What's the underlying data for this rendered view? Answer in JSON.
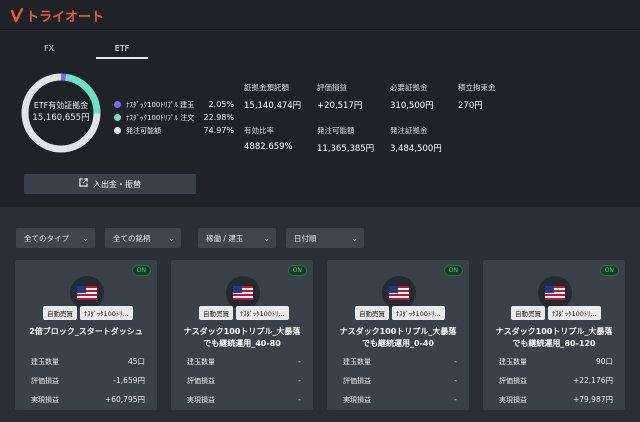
{
  "brand": {
    "name": "トライオート",
    "color": "#e85a3a"
  },
  "tabs": [
    {
      "label": "FX"
    },
    {
      "label": "ETF"
    }
  ],
  "summary": {
    "donut_label": "ETF有効証拠金",
    "donut_value": "15,160,655円",
    "legend": [
      {
        "name": "ﾅｽﾀﾞｯｸ100ﾄﾘﾌﾟﾙ 建玉",
        "pct": "2.05%",
        "color": "#7b68ee",
        "fraction": 0.0205
      },
      {
        "name": "ﾅｽﾀﾞｯｸ100ﾄﾘﾌﾟﾙ 注文",
        "pct": "22.98%",
        "color": "#6fe0c8",
        "fraction": 0.2298
      },
      {
        "name": "発注可能額",
        "pct": "74.97%",
        "color": "#e0e3e6",
        "fraction": 0.7497
      }
    ],
    "stats": [
      {
        "label": "証拠金預託額",
        "value": "15,140,474円"
      },
      {
        "label": "評価損益",
        "value": "+20,517円"
      },
      {
        "label": "必要証拠金",
        "value": "310,500円"
      },
      {
        "label": "積立拘束金",
        "value": "270円"
      },
      {
        "label": "有効比率",
        "value": "4882.659%"
      },
      {
        "label": "発注可能額",
        "value": "11,365,385円"
      },
      {
        "label": "発注証拠金",
        "value": "3,484,500円"
      }
    ],
    "deposit_button": "入出金・振替",
    "deposit_icon": "external-link-icon"
  },
  "filters": [
    {
      "label": "全てのタイプ"
    },
    {
      "label": "全ての銘柄"
    },
    {
      "label": "稼働 / 建玉"
    },
    {
      "label": "日付順"
    }
  ],
  "cards": [
    {
      "status": "ON",
      "tags": [
        "自動売買",
        "ﾅｽﾀﾞｯｸ100ﾄﾘ..."
      ],
      "title_line1": "2倍ブロック_スタートダッシュ",
      "title_line2": "",
      "rows": [
        {
          "label": "建玉数量",
          "value": "45口"
        },
        {
          "label": "評価損益",
          "value": "-1,659円"
        },
        {
          "label": "実現損益",
          "value": "+60,795円"
        }
      ]
    },
    {
      "status": "ON",
      "tags": [
        "自動売買",
        "ﾅｽﾀﾞｯｸ100ﾄﾘ..."
      ],
      "title_line1": "ナスダック100トリプル_大暴落",
      "title_line2": "でも継続運用_40-80",
      "rows": [
        {
          "label": "建玉数量",
          "value": "-"
        },
        {
          "label": "評価損益",
          "value": "-"
        },
        {
          "label": "実現損益",
          "value": "-"
        }
      ]
    },
    {
      "status": "ON",
      "tags": [
        "自動売買",
        "ﾅｽﾀﾞｯｸ100ﾄﾘ..."
      ],
      "title_line1": "ナスダック100トリプル_大暴落",
      "title_line2": "でも継続運用_0-40",
      "rows": [
        {
          "label": "建玉数量",
          "value": "-"
        },
        {
          "label": "評価損益",
          "value": "-"
        },
        {
          "label": "実現損益",
          "value": "-"
        }
      ]
    },
    {
      "status": "ON",
      "tags": [
        "自動売買",
        "ﾅｽﾀﾞｯｸ100ﾄﾘ..."
      ],
      "title_line1": "ナスダック100トリプル_大暴落",
      "title_line2": "でも継続運用_80-120",
      "rows": [
        {
          "label": "建玉数量",
          "value": "90口"
        },
        {
          "label": "評価損益",
          "value": "+22,176円"
        },
        {
          "label": "実現損益",
          "value": "+79,987円"
        }
      ]
    }
  ]
}
